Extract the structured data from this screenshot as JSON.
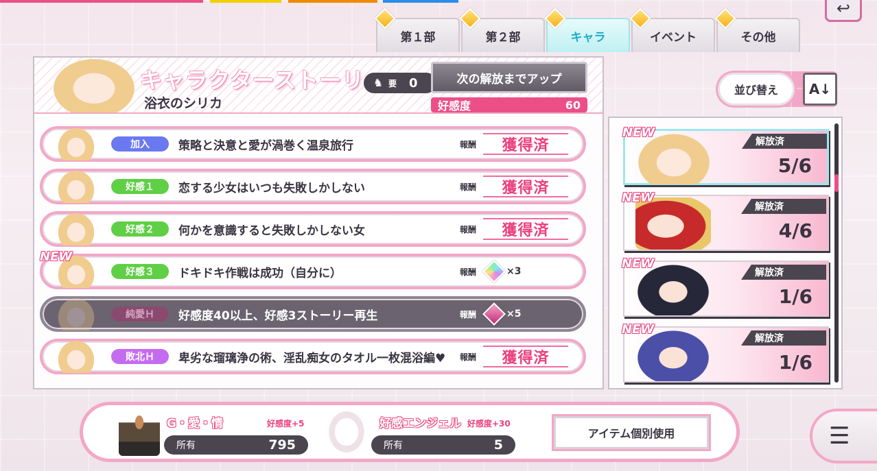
{
  "tabs": [
    {
      "label": "第１部",
      "active": false
    },
    {
      "label": "第２部",
      "active": false
    },
    {
      "label": "キャラ",
      "active": true
    },
    {
      "label": "イベント",
      "active": false
    },
    {
      "label": "その他",
      "active": false
    }
  ],
  "header": {
    "title": "キャラクターストーリー",
    "character_name": "浴衣のシリカ",
    "requirement_label": "要",
    "requirement_value": "0",
    "unlock_button": "次の解放までアップ",
    "affinity_label": "好感度",
    "affinity_value": "60"
  },
  "stories": [
    {
      "tag": "加入",
      "tag_color": "#6a79f0",
      "title": "策略と決意と愛が渦巻く温泉旅行",
      "reward_label": "報酬",
      "reward": "獲得済",
      "locked": false,
      "new": false
    },
    {
      "tag": "好感１",
      "tag_color": "#5fcf45",
      "title": "恋する少女はいつも失敗しかしない",
      "reward_label": "報酬",
      "reward": "獲得済",
      "locked": false,
      "new": false
    },
    {
      "tag": "好感２",
      "tag_color": "#5fcf45",
      "title": "何かを意識すると失敗しかしない女",
      "reward_label": "報酬",
      "reward": "獲得済",
      "locked": false,
      "new": false
    },
    {
      "tag": "好感３",
      "tag_color": "#5fcf45",
      "title": "ドキドキ作戦は成功（自分に）",
      "reward_label": "報酬",
      "reward_qty": "×3",
      "locked": false,
      "new": true,
      "new_label": "NEW"
    },
    {
      "tag": "純愛Ｈ",
      "tag_color": "#b04a82",
      "title": "好感度40以上、好感3ストーリー再生",
      "reward_label": "報酬",
      "reward_qty": "×5",
      "locked": true,
      "new": false
    },
    {
      "tag": "敗北Ｈ",
      "tag_color": "#c46cf0",
      "title": "卑劣な瑠璃浄の術、淫乱痴女のタオル一枚混浴編♥",
      "reward_label": "報酬",
      "reward": "獲得済",
      "locked": false,
      "new": false
    }
  ],
  "sort": {
    "label": "並び替え",
    "az_label": "A↓"
  },
  "characters": [
    {
      "status": "解放済",
      "count": "5/6",
      "new_label": "NEW",
      "selected": true
    },
    {
      "status": "解放済",
      "count": "4/6",
      "new_label": "NEW",
      "selected": false
    },
    {
      "status": "解放済",
      "count": "1/6",
      "new_label": "NEW",
      "selected": false
    },
    {
      "status": "解放済",
      "count": "1/6",
      "new_label": "NEW",
      "selected": false
    }
  ],
  "items": [
    {
      "name": "G・愛・情",
      "bonus": "好感度+5",
      "owned_label": "所有",
      "owned_value": "795"
    },
    {
      "name": "好感エンジェル",
      "bonus": "好感度+30",
      "owned_label": "所有",
      "owned_value": "5"
    }
  ],
  "use_item_button": "アイテム個別使用"
}
